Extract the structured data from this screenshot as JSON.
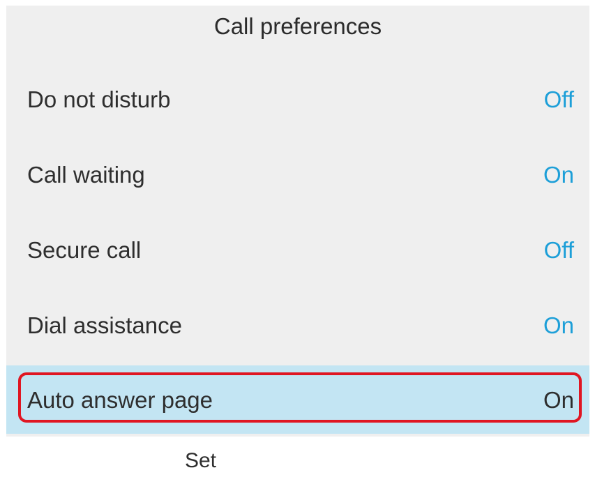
{
  "header": {
    "title": "Call preferences"
  },
  "preferences": [
    {
      "label": "Do not disturb",
      "value": "Off"
    },
    {
      "label": "Call waiting",
      "value": "On"
    },
    {
      "label": "Secure call",
      "value": "Off"
    },
    {
      "label": "Dial assistance",
      "value": "On"
    },
    {
      "label": "Auto answer page",
      "value": "On",
      "selected": true
    }
  ],
  "softkeys": {
    "set_label": "Set"
  },
  "colors": {
    "value_text": "#1d9fd8",
    "selected_row": "#c3e5f3",
    "highlight_border": "#e01622",
    "screen_background": "#efefef"
  }
}
